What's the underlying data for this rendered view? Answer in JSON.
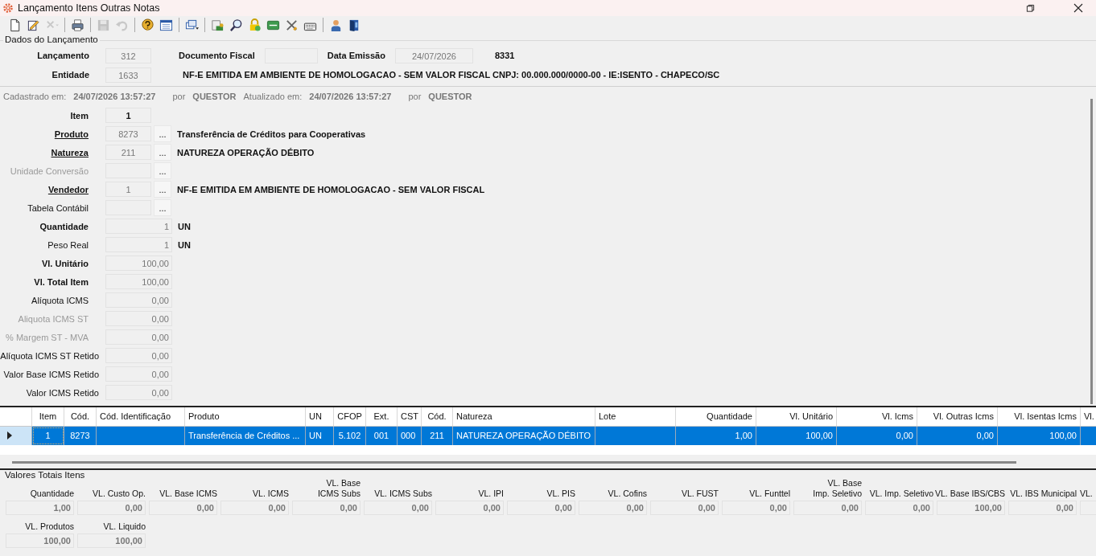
{
  "window": {
    "title": "Lançamento Itens Outras Notas"
  },
  "toolbar": [
    {
      "kind": "new",
      "disabled": false
    },
    {
      "kind": "edit",
      "disabled": false
    },
    {
      "kind": "delete",
      "disabled": true
    },
    {
      "kind": "sep"
    },
    {
      "kind": "print",
      "disabled": false
    },
    {
      "kind": "sep"
    },
    {
      "kind": "save",
      "disabled": true
    },
    {
      "kind": "undo",
      "disabled": true
    },
    {
      "kind": "sep"
    },
    {
      "kind": "help",
      "disabled": false
    },
    {
      "kind": "form",
      "disabled": false
    },
    {
      "kind": "sep"
    },
    {
      "kind": "windows",
      "disabled": false
    },
    {
      "kind": "sep"
    },
    {
      "kind": "report",
      "disabled": false
    },
    {
      "kind": "search",
      "disabled": false
    },
    {
      "kind": "lock",
      "disabled": false
    },
    {
      "kind": "card",
      "disabled": false
    },
    {
      "kind": "tools",
      "disabled": false
    },
    {
      "kind": "keyboard",
      "disabled": false
    },
    {
      "kind": "sep"
    },
    {
      "kind": "user",
      "disabled": false
    },
    {
      "kind": "exit",
      "disabled": false
    }
  ],
  "header": {
    "title": "Dados do Lançamento",
    "lancamento_label": "Lançamento",
    "lancamento": "312",
    "documento_label": "Documento Fiscal",
    "data_label": "Data Emissão",
    "data": "24/07/2026",
    "numero": "8331",
    "entidade_label": "Entidade",
    "entidade": "1633",
    "entidade_desc": "NF-E EMITIDA EM AMBIENTE DE HOMOLOGACAO - SEM VALOR FISCAL CNPJ: 00.000.000/0000-00 - IE:ISENTO - CHAPECO/SC"
  },
  "audit": [
    "Cadastrado em:",
    "24/07/2026 13:57:27",
    "por",
    "QUESTOR",
    "Atualizado em:",
    "24/07/2026 13:57:27",
    "por",
    "QUESTOR"
  ],
  "fields": [
    {
      "label": "Item",
      "kind": "code",
      "bold": true,
      "link": false,
      "disabled": false,
      "value": "1"
    },
    {
      "label": "Produto",
      "kind": "lookup",
      "bold": true,
      "link": true,
      "disabled": false,
      "value": "8273",
      "button": "...",
      "desc": "Transferência de Créditos para Cooperativas"
    },
    {
      "label": "Natureza",
      "kind": "lookup",
      "bold": true,
      "link": true,
      "disabled": false,
      "value": "211",
      "button": "...",
      "desc": "NATUREZA OPERAÇÃO DÉBITO"
    },
    {
      "label": "Unidade Conversão",
      "kind": "lookup",
      "bold": false,
      "link": false,
      "disabled": true,
      "button": "..."
    },
    {
      "label": "Vendedor",
      "kind": "lookup",
      "bold": true,
      "link": true,
      "disabled": false,
      "value": "1",
      "button": "...",
      "desc": "NF-E EMITIDA EM AMBIENTE DE HOMOLOGACAO - SEM VALOR FISCAL"
    },
    {
      "label": "Tabela Contábil",
      "kind": "lookup",
      "bold": false,
      "link": false,
      "disabled": false,
      "button": "..."
    },
    {
      "label": "Quantidade",
      "kind": "number",
      "bold": true,
      "link": false,
      "disabled": false,
      "value": "1",
      "unit": "UN"
    },
    {
      "label": "Peso Real",
      "kind": "number",
      "bold": false,
      "link": false,
      "disabled": false,
      "value": "1",
      "unit": "UN"
    },
    {
      "label": "Vl. Unitário",
      "kind": "number",
      "bold": true,
      "link": false,
      "disabled": false,
      "value": "100,00"
    },
    {
      "label": "Vl. Total Item",
      "kind": "number",
      "bold": true,
      "link": false,
      "disabled": false,
      "value": "100,00"
    },
    {
      "label": "Alíquota ICMS",
      "kind": "number",
      "bold": false,
      "link": false,
      "disabled": false,
      "value": "0,00"
    },
    {
      "label": "Aliquota ICMS ST",
      "kind": "number",
      "bold": false,
      "link": false,
      "disabled": true,
      "value": "0,00"
    },
    {
      "label": "% Margem ST - MVA",
      "kind": "number",
      "bold": false,
      "link": false,
      "disabled": true,
      "value": "0,00"
    },
    {
      "label": "Alíquota ICMS ST Retido",
      "kind": "number",
      "bold": false,
      "link": false,
      "disabled": false,
      "value": "0,00"
    },
    {
      "label": "Valor Base ICMS Retido",
      "kind": "number",
      "bold": false,
      "link": false,
      "disabled": false,
      "value": "0,00"
    },
    {
      "label": "Valor ICMS Retido",
      "kind": "number",
      "bold": false,
      "link": false,
      "disabled": false,
      "value": "0,00"
    }
  ],
  "table": {
    "columns": [
      "Item",
      "Cód.",
      "Cód. Identificação",
      "Produto",
      "UN",
      "CFOP",
      "Ext.",
      "CST",
      "Cód.",
      "Natureza",
      "Lote",
      "Quantidade",
      "Vl. Unitário",
      "Vl. Icms",
      "Vl. Outras Icms",
      "Vl. Isentas Icms",
      "Vl."
    ],
    "rows": [
      {
        "selected": true,
        "cells": [
          "1",
          "8273",
          "",
          "Transferência de Créditos ...",
          "UN",
          "5.102",
          "001",
          "000",
          "211",
          "NATUREZA OPERAÇÃO DÉBITO",
          "",
          "1,00",
          "100,00",
          "0,00",
          "0,00",
          "100,00",
          ""
        ]
      }
    ]
  },
  "totals": {
    "title": "Valores Totais Itens",
    "items": [
      {
        "label": "Quantidade",
        "value": "1,00"
      },
      {
        "label": "VL. Custo Op.",
        "value": "0,00"
      },
      {
        "label": "VL. Base ICMS",
        "value": "0,00"
      },
      {
        "label": "VL. ICMS",
        "value": "0,00"
      },
      {
        "label": "VL. Base\nICMS Subs",
        "value": "0,00"
      },
      {
        "label": "VL. ICMS Subs",
        "value": "0,00"
      },
      {
        "label": "VL. IPI",
        "value": "0,00"
      },
      {
        "label": "VL. PIS",
        "value": "0,00"
      },
      {
        "label": "VL. Cofins",
        "value": "0,00"
      },
      {
        "label": "VL. FUST",
        "value": "0,00"
      },
      {
        "label": "VL. Funttel",
        "value": "0,00"
      },
      {
        "label": "VL. Base\nImp. Seletivo",
        "value": "0,00"
      },
      {
        "label": "VL. Imp. Seletivo",
        "value": "0,00"
      },
      {
        "label": "VL. Base IBS/CBS",
        "value": "100,00"
      },
      {
        "label": "VL. IBS Municipal",
        "value": "0,00"
      },
      {
        "label": "VL."
      }
    ],
    "items2": [
      {
        "label": "VL. Produtos",
        "value": "100,00"
      },
      {
        "label": "VL. Liquido",
        "value": "100,00"
      }
    ]
  }
}
